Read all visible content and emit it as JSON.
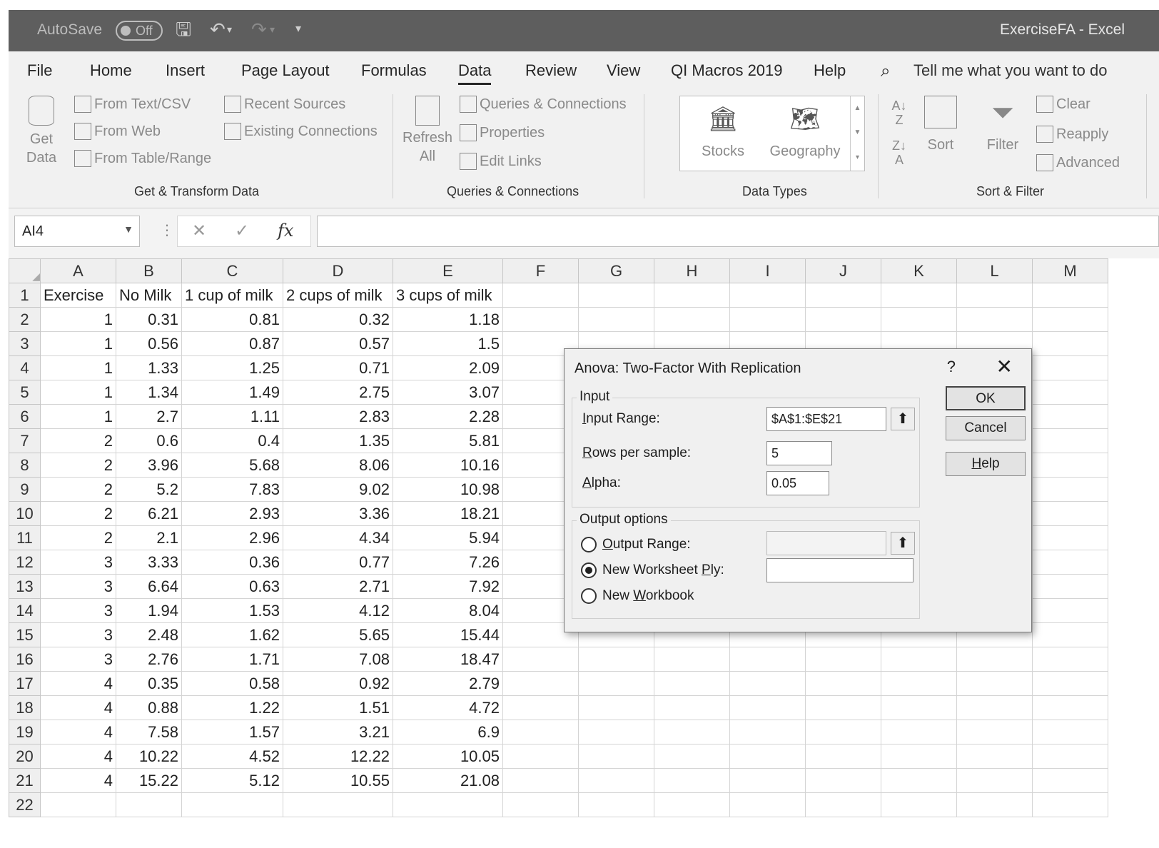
{
  "titlebar": {
    "autosave": "AutoSave",
    "toggle": "Off",
    "document": "ExerciseFA  -  Excel"
  },
  "tabs": [
    "File",
    "Home",
    "Insert",
    "Page Layout",
    "Formulas",
    "Data",
    "Review",
    "View",
    "QI Macros 2019",
    "Help"
  ],
  "active_tab": "Data",
  "tell_me": "Tell me what you want to do",
  "ribbon": {
    "get_data": [
      "Get",
      "Data"
    ],
    "from_text": "From Text/CSV",
    "from_web": "From Web",
    "from_table": "From Table/Range",
    "recent_sources": "Recent Sources",
    "existing_connections": "Existing Connections",
    "group_get_transform": "Get & Transform Data",
    "refresh_all": [
      "Refresh",
      "All"
    ],
    "queries_connections": "Queries & Connections",
    "properties": "Properties",
    "edit_links": "Edit Links",
    "group_queries": "Queries & Connections",
    "stocks": "Stocks",
    "geography": "Geography",
    "group_datatypes": "Data Types",
    "sort": "Sort",
    "filter": "Filter",
    "clear": "Clear",
    "reapply": "Reapply",
    "advanced": "Advanced",
    "group_sort": "Sort & Filter"
  },
  "formula_bar": {
    "name_box": "AI4",
    "cancel": "✕",
    "enter": "✓",
    "fx": "fx",
    "value": ""
  },
  "columns": [
    "A",
    "B",
    "C",
    "D",
    "E",
    "F",
    "G",
    "H",
    "I",
    "J",
    "K",
    "L",
    "M"
  ],
  "header_row": [
    "Exercise",
    "No Milk",
    "1 cup of milk",
    "2 cups of milk",
    "3 cups of milk"
  ],
  "rows": [
    [
      "1",
      "0.31",
      "0.81",
      "0.32",
      "1.18"
    ],
    [
      "1",
      "0.56",
      "0.87",
      "0.57",
      "1.5"
    ],
    [
      "1",
      "1.33",
      "1.25",
      "0.71",
      "2.09"
    ],
    [
      "1",
      "1.34",
      "1.49",
      "2.75",
      "3.07"
    ],
    [
      "1",
      "2.7",
      "1.11",
      "2.83",
      "2.28"
    ],
    [
      "2",
      "0.6",
      "0.4",
      "1.35",
      "5.81"
    ],
    [
      "2",
      "3.96",
      "5.68",
      "8.06",
      "10.16"
    ],
    [
      "2",
      "5.2",
      "7.83",
      "9.02",
      "10.98"
    ],
    [
      "2",
      "6.21",
      "2.93",
      "3.36",
      "18.21"
    ],
    [
      "2",
      "2.1",
      "2.96",
      "4.34",
      "5.94"
    ],
    [
      "3",
      "3.33",
      "0.36",
      "0.77",
      "7.26"
    ],
    [
      "3",
      "6.64",
      "0.63",
      "2.71",
      "7.92"
    ],
    [
      "3",
      "1.94",
      "1.53",
      "4.12",
      "8.04"
    ],
    [
      "3",
      "2.48",
      "1.62",
      "5.65",
      "15.44"
    ],
    [
      "3",
      "2.76",
      "1.71",
      "7.08",
      "18.47"
    ],
    [
      "4",
      "0.35",
      "0.58",
      "0.92",
      "2.79"
    ],
    [
      "4",
      "0.88",
      "1.22",
      "1.51",
      "4.72"
    ],
    [
      "4",
      "7.58",
      "1.57",
      "3.21",
      "6.9"
    ],
    [
      "4",
      "10.22",
      "4.52",
      "12.22",
      "10.05"
    ],
    [
      "4",
      "15.22",
      "5.12",
      "10.55",
      "21.08"
    ],
    [
      "",
      "",
      "",
      "",
      ""
    ]
  ],
  "dialog": {
    "title": "Anova: Two-Factor With Replication",
    "help_mark": "?",
    "close": "✕",
    "input_legend": "Input",
    "input_range_label": "Input Range:",
    "input_range_value": "$A$1:$E$21",
    "rows_label": "Rows per sample:",
    "rows_value": "5",
    "alpha_label": "Alpha:",
    "alpha_value": "0.05",
    "ok": "OK",
    "cancel": "Cancel",
    "help": "Help",
    "output_legend": "Output options",
    "output_range": "Output Range:",
    "new_ply": "New Worksheet Ply:",
    "new_workbook": "New Workbook",
    "output_range_value": "",
    "new_ply_value": ""
  }
}
